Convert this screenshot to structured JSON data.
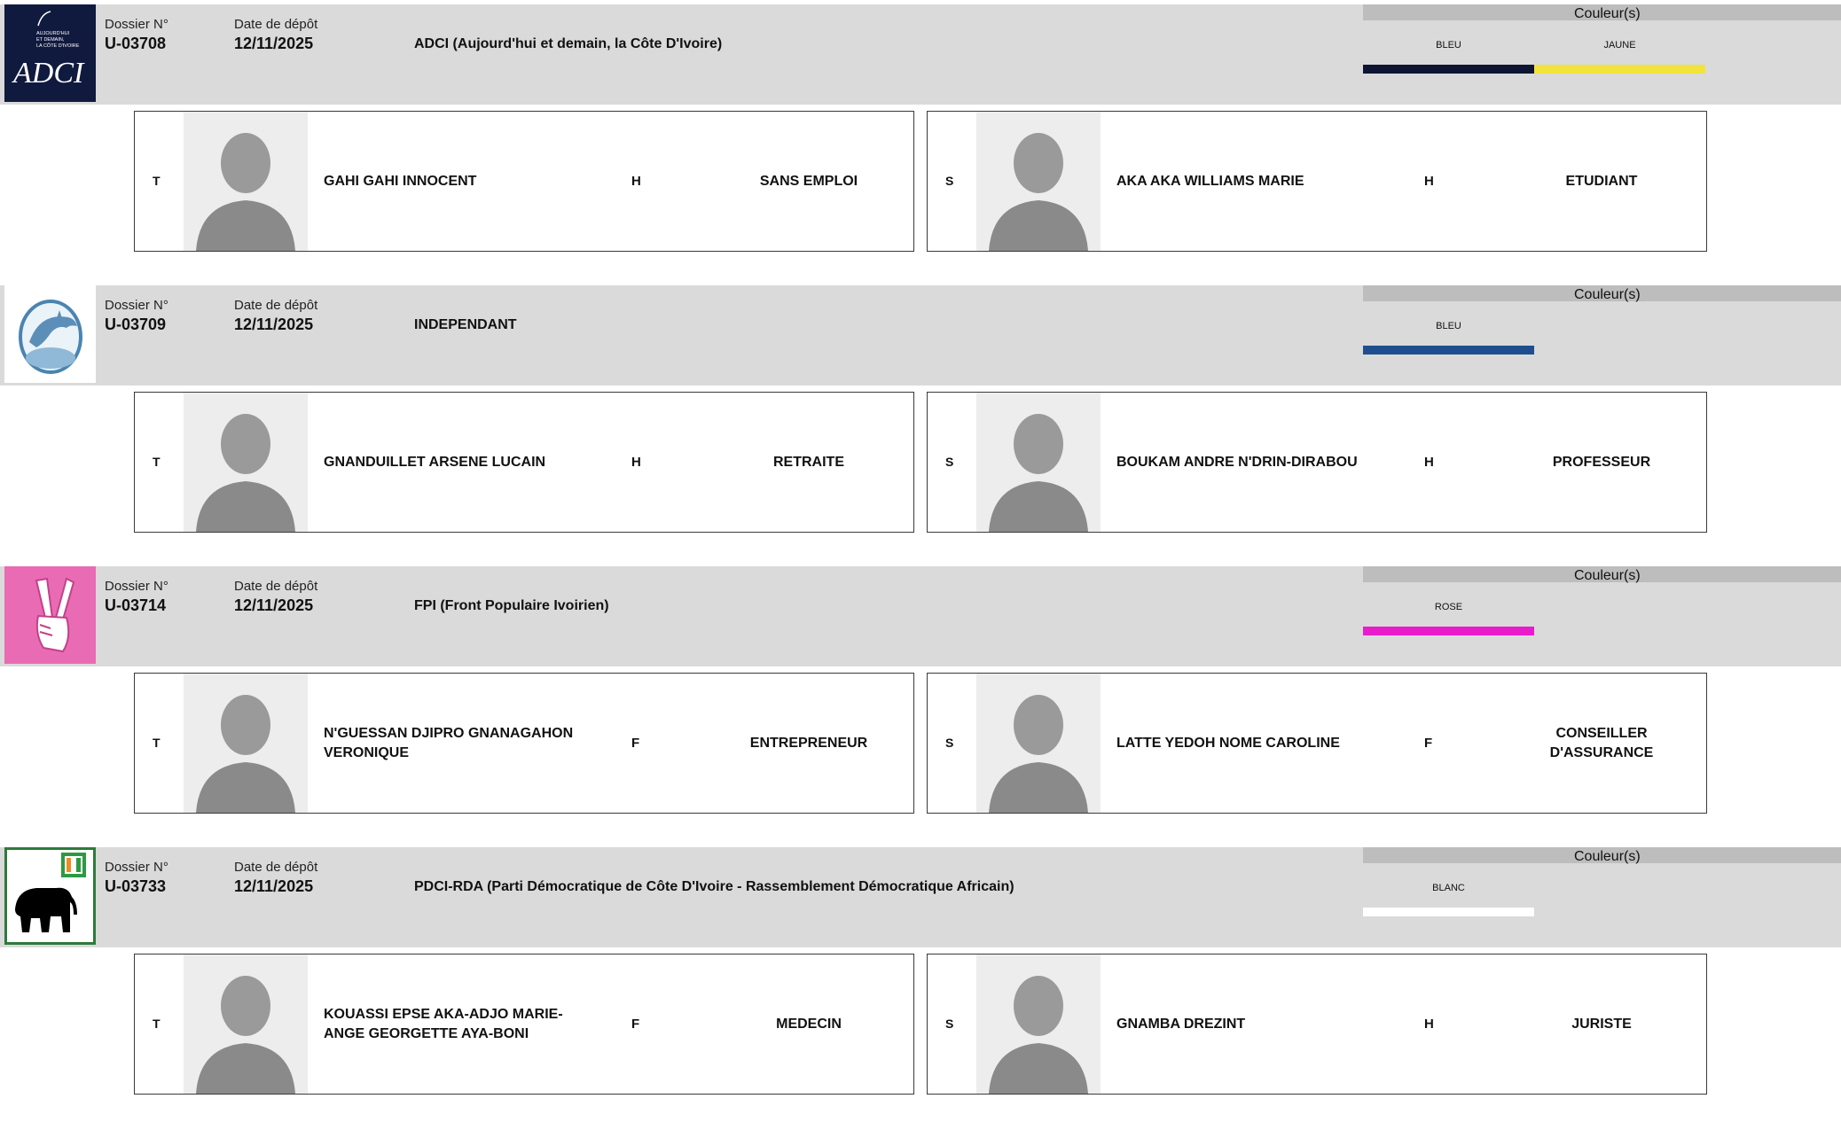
{
  "labels": {
    "dossier": "Dossier N°",
    "date": "Date de dépôt",
    "colors_title": "Couleur(s)"
  },
  "entries": [
    {
      "dossier": "U-03708",
      "date": "12/11/2025",
      "party": "ADCI (Aujourd'hui et demain, la Côte D'Ivoire)",
      "logo": {
        "type": "adci-logo",
        "text": "ADCI",
        "subtext": [
          "AUJOURD'HUI",
          "ET DEMAIN,",
          "LA CÔTE D'IVOIRE"
        ]
      },
      "colors": [
        {
          "name": "BLEU",
          "hex": "#0e1533"
        },
        {
          "name": "JAUNE",
          "hex": "#f2e33a"
        }
      ],
      "candidates": [
        {
          "role": "T",
          "name": "GAHI GAHI INNOCENT",
          "gender": "H",
          "job": "SANS EMPLOI"
        },
        {
          "role": "S",
          "name": "AKA AKA WILLIAMS MARIE",
          "gender": "H",
          "job": "ETUDIANT"
        }
      ]
    },
    {
      "dossier": "U-03709",
      "date": "12/11/2025",
      "party": "INDEPENDANT",
      "logo": {
        "type": "dolphin-logo"
      },
      "colors": [
        {
          "name": "BLEU",
          "hex": "#1f4e8e"
        }
      ],
      "candidates": [
        {
          "role": "T",
          "name": "GNANDUILLET ARSENE LUCAIN",
          "gender": "H",
          "job": "RETRAITE"
        },
        {
          "role": "S",
          "name": "BOUKAM ANDRE N'DRIN-DIRABOU",
          "gender": "H",
          "job": "PROFESSEUR"
        }
      ]
    },
    {
      "dossier": "U-03714",
      "date": "12/11/2025",
      "party": "FPI (Front Populaire Ivoirien)",
      "logo": {
        "type": "victory-hand-logo"
      },
      "colors": [
        {
          "name": "ROSE",
          "hex": "#e81ccb"
        }
      ],
      "candidates": [
        {
          "role": "T",
          "name": "N'GUESSAN DJIPRO GNANAGAHON VERONIQUE",
          "gender": "F",
          "job": "ENTREPRENEUR"
        },
        {
          "role": "S",
          "name": "LATTE YEDOH NOME CAROLINE",
          "gender": "F",
          "job": "CONSEILLER D'ASSURANCE"
        }
      ]
    },
    {
      "dossier": "U-03733",
      "date": "12/11/2025",
      "party": "PDCI-RDA (Parti Démocratique de Côte D'Ivoire - Rassemblement Démocratique Africain)",
      "logo": {
        "type": "elephant-logo"
      },
      "colors": [
        {
          "name": "BLANC",
          "hex": "#ffffff"
        }
      ],
      "candidates": [
        {
          "role": "T",
          "name": "KOUASSI EPSE AKA-ADJO MARIE-ANGE GEORGETTE AYA-BONI",
          "gender": "F",
          "job": "MEDECIN"
        },
        {
          "role": "S",
          "name": "GNAMBA DREZINT",
          "gender": "H",
          "job": "JURISTE"
        }
      ]
    }
  ]
}
